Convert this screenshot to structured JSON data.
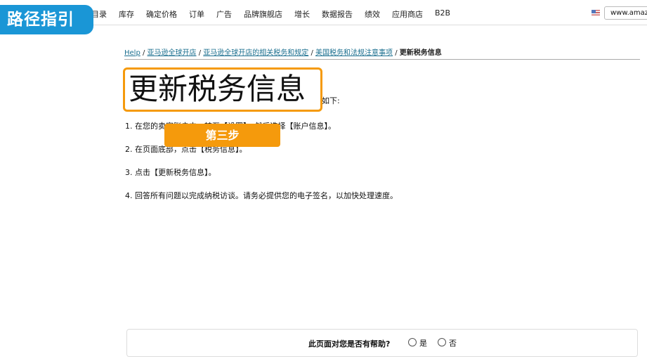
{
  "nav": {
    "items": [
      "目录",
      "库存",
      "确定价格",
      "订单",
      "广告",
      "品牌旗舰店",
      "增长",
      "数据报告",
      "绩效",
      "应用商店",
      "B2B"
    ],
    "store": "www.amazon.com"
  },
  "badge": "路径指引",
  "breadcrumb": {
    "items": [
      "Help",
      "亚马逊全球开店",
      "亚马逊全球开店的相关税务和规定",
      "美国税务和法规注意事项"
    ],
    "current": "更新税务信息"
  },
  "title": "更新税务信息",
  "intro": "如下:",
  "steps": [
    "1. 在您的卖家账户中，转至【设置】，然后选择【账户信息】。",
    "2. 在页面底部，点击【税务信息】。",
    "3. 点击【更新税务信息】。",
    "4. 回答所有问题以完成纳税访谈。请务必提供您的电子签名，以加快处理速度。"
  ],
  "step_label": "第三步",
  "feedback": {
    "question": "此页面对您是否有帮助?",
    "yes": "是",
    "no": "否"
  }
}
